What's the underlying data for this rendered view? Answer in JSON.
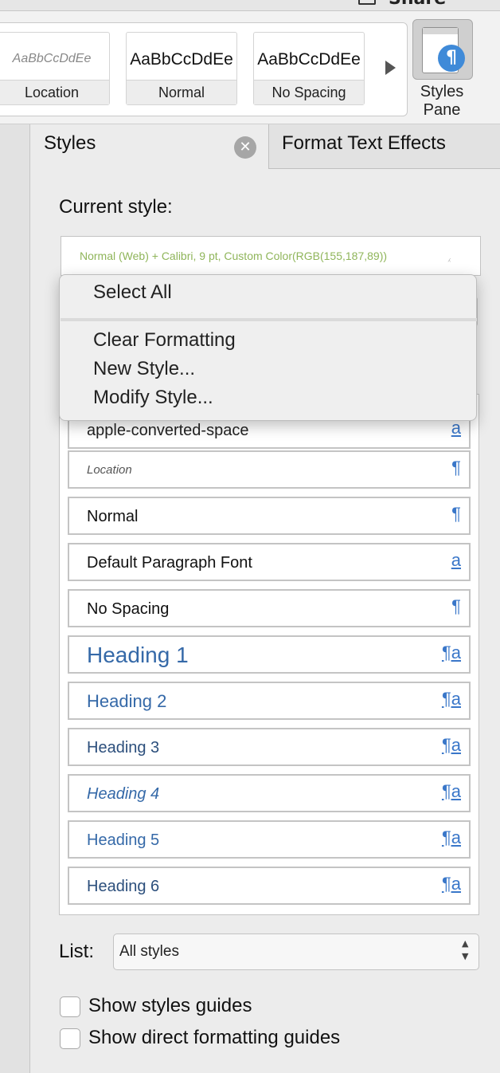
{
  "toolbar": {
    "share_label": "Share"
  },
  "gallery": {
    "tiles": [
      {
        "sample": "AaBbCcDdEe",
        "caption": "Location"
      },
      {
        "sample": "AaBbCcDdEe",
        "caption": "Normal"
      },
      {
        "sample": "AaBbCcDdEe",
        "caption": "No Spacing"
      }
    ],
    "styles_pane_label": "Styles Pane",
    "pilcrow": "¶"
  },
  "tabs": {
    "styles": "Styles",
    "close_glyph": "✕",
    "format": "Format Text Effects"
  },
  "panel": {
    "current_style_label": "Current style:",
    "current_style_value": "Normal (Web) + Calibri, 9 pt, Custom Color(RGB(155,187,89))",
    "current_style_color": "#8fb55a"
  },
  "menu": {
    "items": [
      "Select All",
      "Clear Formatting",
      "New Style...",
      "Modify Style..."
    ]
  },
  "style_list": {
    "rows": [
      {
        "name": "apple-converted-space",
        "icon": "a"
      },
      {
        "name": "Location",
        "icon": "¶"
      },
      {
        "name": "Normal",
        "icon": "¶"
      },
      {
        "name": "Default Paragraph Font",
        "icon": "a"
      },
      {
        "name": "No Spacing",
        "icon": "¶"
      },
      {
        "name": "Heading 1",
        "icon": "¶a"
      },
      {
        "name": "Heading 2",
        "icon": "¶a"
      },
      {
        "name": "Heading 3",
        "icon": "¶a"
      },
      {
        "name": "Heading 4",
        "icon": "¶a"
      },
      {
        "name": "Heading 5",
        "icon": "¶a"
      },
      {
        "name": "Heading 6",
        "icon": "¶a"
      }
    ]
  },
  "list": {
    "label": "List:",
    "value": "All styles"
  },
  "checkboxes": {
    "styles_guides": "Show styles guides",
    "direct_formatting_guides": "Show direct formatting guides"
  },
  "colors": {
    "accent": "#3a77c9",
    "badge": "#3f8ad8"
  }
}
